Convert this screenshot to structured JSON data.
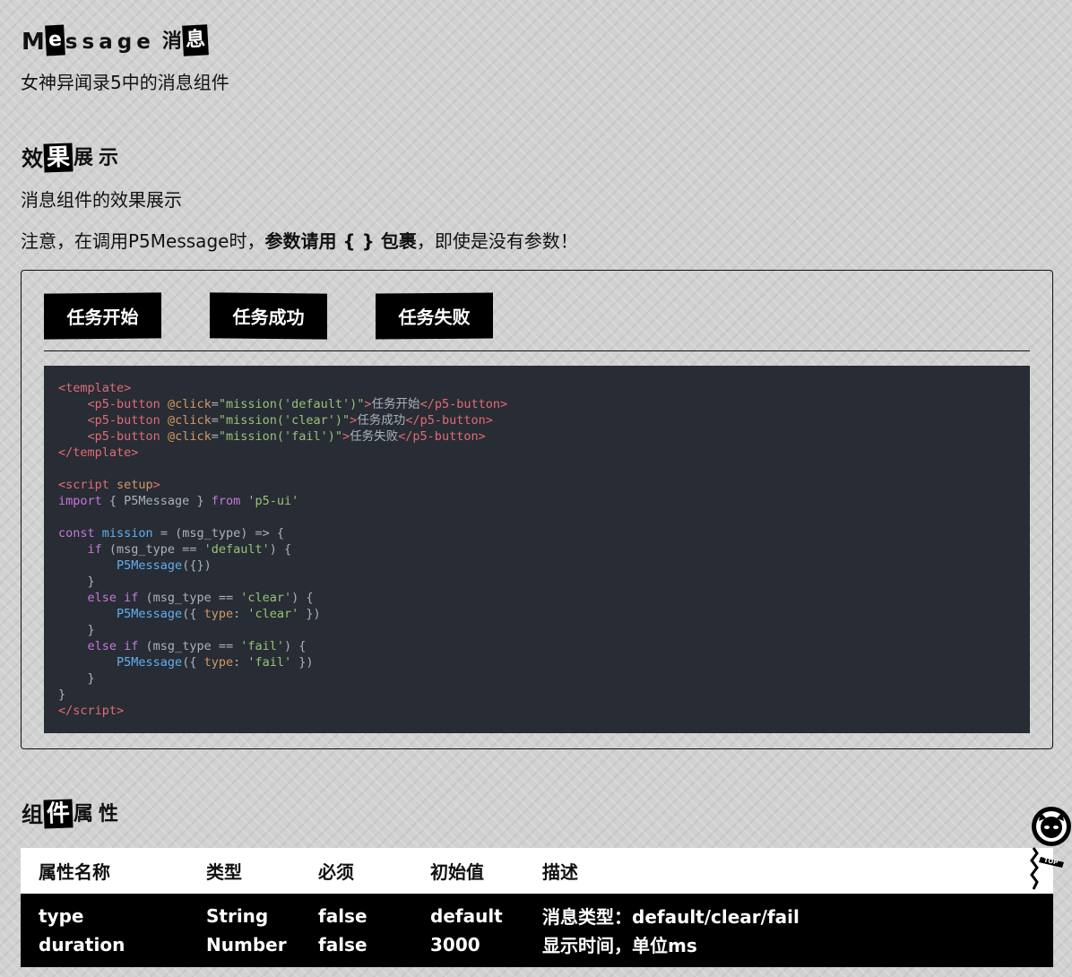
{
  "header": {
    "title_chars": [
      "M",
      "e",
      "s",
      "s",
      "a",
      "g",
      "e",
      "消",
      "息"
    ],
    "subtitle": "女神异闻录5中的消息组件"
  },
  "demo_section": {
    "title_chars": [
      "效",
      "果",
      "展",
      "示"
    ],
    "desc": "消息组件的效果展示",
    "note_prefix": "注意，在调用P5Message时，",
    "note_bold": "参数请用 { } 包裹",
    "note_suffix": "，即使是没有参数！",
    "buttons": [
      {
        "label": "任务开始"
      },
      {
        "label": "任务成功"
      },
      {
        "label": "任务失败"
      }
    ]
  },
  "props_section": {
    "title_chars": [
      "组",
      "件",
      "属",
      "性"
    ],
    "columns": [
      "属性名称",
      "类型",
      "必须",
      "初始值",
      "描述"
    ],
    "rows": [
      [
        "type",
        "String",
        "false",
        "default",
        "消息类型：default/clear/fail"
      ],
      [
        "duration",
        "Number",
        "false",
        "3000",
        "显示时间，单位ms"
      ]
    ]
  },
  "top_button": {
    "label": "TOP"
  },
  "colors": {
    "background": "#d1d1d1",
    "code_bg": "#282c34",
    "accent": "#000000"
  }
}
